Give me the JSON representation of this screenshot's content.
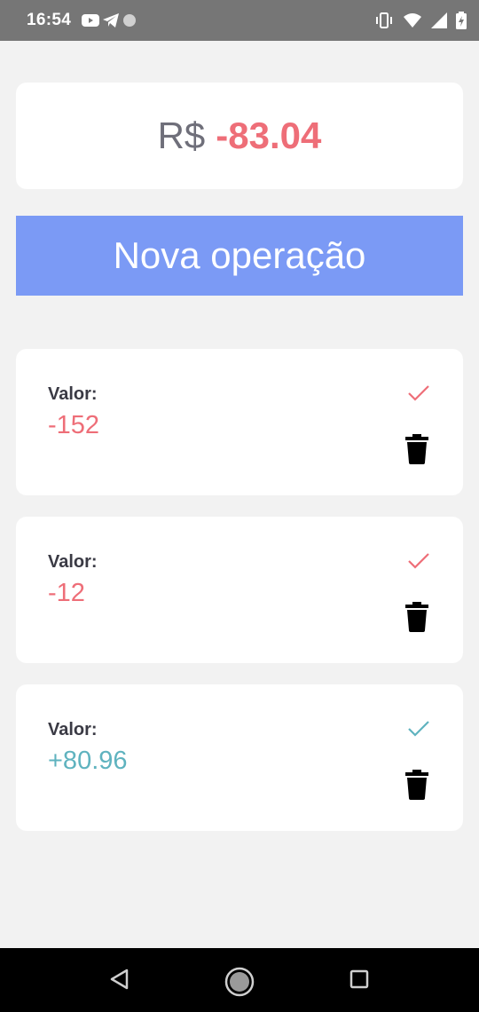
{
  "status_bar": {
    "time": "16:54",
    "icons": [
      "youtube-icon",
      "telegram-icon",
      "circle-notification-icon",
      "vibrate-icon",
      "wifi-icon",
      "signal-icon",
      "battery-charging-icon"
    ]
  },
  "balance": {
    "currency": "R$",
    "amount": "-83.04",
    "amount_color": "#ee6e78"
  },
  "new_operation": {
    "label": "Nova operação",
    "color": "#7b9af5"
  },
  "operations": [
    {
      "label": "Valor:",
      "value": "-152",
      "color": "#ee6e78",
      "check_icon": "check-icon",
      "delete_icon": "trash-icon"
    },
    {
      "label": "Valor:",
      "value": "-12",
      "color": "#ee6e78",
      "check_icon": "check-icon",
      "delete_icon": "trash-icon"
    },
    {
      "label": "Valor:",
      "value": "+80.96",
      "color": "#5fb3bf",
      "check_icon": "check-icon",
      "delete_icon": "trash-icon"
    }
  ],
  "nav_bar": {
    "icons": [
      "back-icon",
      "home-icon",
      "recents-icon"
    ]
  }
}
